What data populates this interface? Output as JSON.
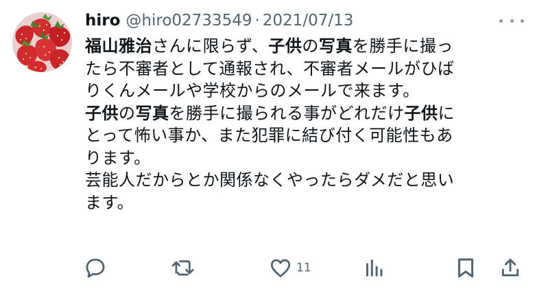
{
  "tweet": {
    "display_name": "hiro",
    "handle": "@hiro02733549",
    "separator": "·",
    "date": "2021/07/13",
    "lines": [
      [
        {
          "t": "福山雅治",
          "b": true
        },
        {
          "t": "さんに限らず、",
          "b": false
        },
        {
          "t": "子供",
          "b": true
        },
        {
          "t": "の",
          "b": false
        },
        {
          "t": "写真",
          "b": true
        },
        {
          "t": "を勝手に撮っ",
          "b": false
        }
      ],
      [
        {
          "t": "たら不審者として通報され、不審者メールがひば",
          "b": false
        }
      ],
      [
        {
          "t": "りくんメールや学校からのメールで来ます。",
          "b": false
        }
      ],
      [
        {
          "t": "子供",
          "b": true
        },
        {
          "t": "の",
          "b": false
        },
        {
          "t": "写真",
          "b": true
        },
        {
          "t": "を勝手に撮られる事がどれだけ",
          "b": false
        },
        {
          "t": "子供",
          "b": true
        },
        {
          "t": "に",
          "b": false
        }
      ],
      [
        {
          "t": "とって怖い事か、また犯罪に結び付く可能性もあ",
          "b": false
        }
      ],
      [
        {
          "t": "ります。",
          "b": false
        }
      ],
      [
        {
          "t": "芸能人だからとか関係なくやったらダメだと思い",
          "b": false
        }
      ],
      [
        {
          "t": "ます。",
          "b": false
        }
      ]
    ],
    "actions": {
      "reply": {
        "icon": "reply-icon"
      },
      "retweet": {
        "icon": "retweet-icon"
      },
      "like": {
        "icon": "heart-icon",
        "count": "11"
      },
      "views": {
        "icon": "analytics-icon"
      },
      "bookmark": {
        "icon": "bookmark-icon"
      },
      "share": {
        "icon": "share-icon"
      }
    },
    "colors": {
      "text": "#0f1419",
      "secondary": "#536471",
      "background": "#ffffff"
    }
  }
}
